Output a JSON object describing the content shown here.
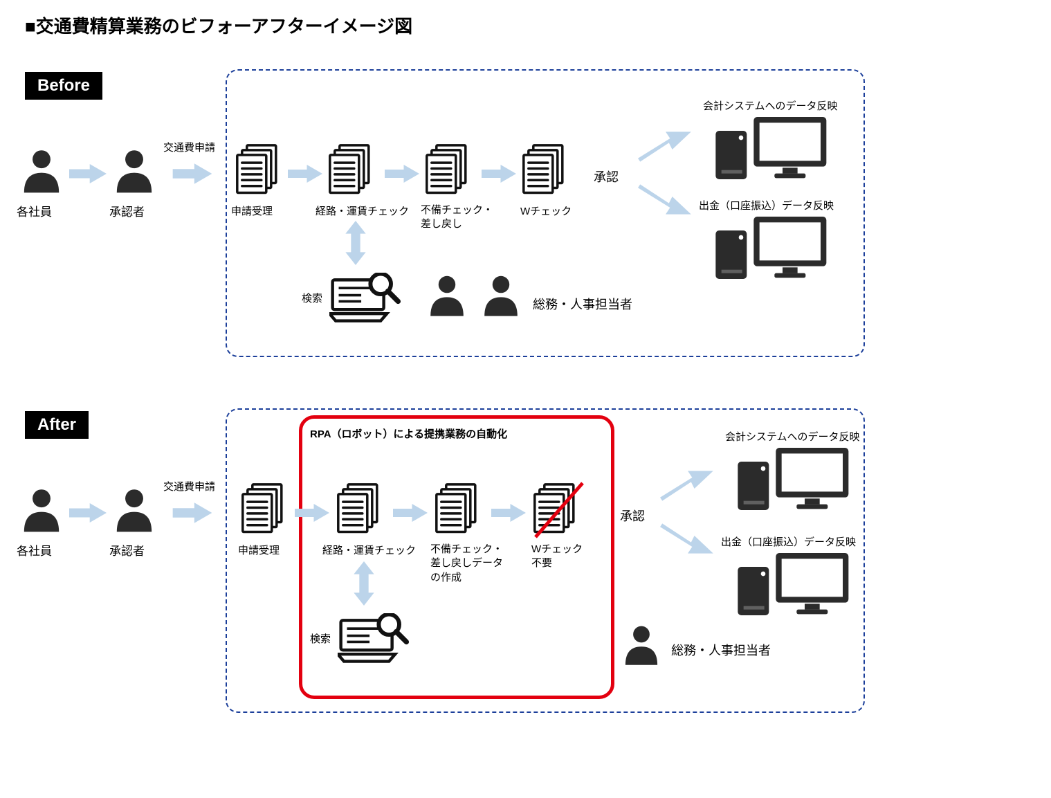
{
  "heading": "■交通費精算業務のビフォーアフターイメージ図",
  "labels": {
    "before": "Before",
    "after": "After",
    "employees": "各社員",
    "approver": "承認者",
    "application": "交通費申請",
    "accepted": "申請受理",
    "routeFareCheck": "経路・運賃チェック",
    "defectCheckReturn": "不備チェック・\n差し戻し",
    "defectCheckReturnData": "不備チェック・\n差し戻しデータ\nの作成",
    "wCheck": "Wチェック",
    "wCheckNo": "Wチェック\n不要",
    "approval": "承認",
    "search": "検索",
    "hrStaff": "総務・人事担当者",
    "acctReflect": "会計システムへのデータ反映",
    "payoutReflect": "出金（口座振込）データ反映",
    "rpaTitle": "RPA（ロボット）による提携業務の自動化"
  },
  "colors": {
    "arrow": "#bcd4ea",
    "icon": "#2b2b2b",
    "dashed": "#1c3f9a",
    "red": "#e3000f"
  }
}
